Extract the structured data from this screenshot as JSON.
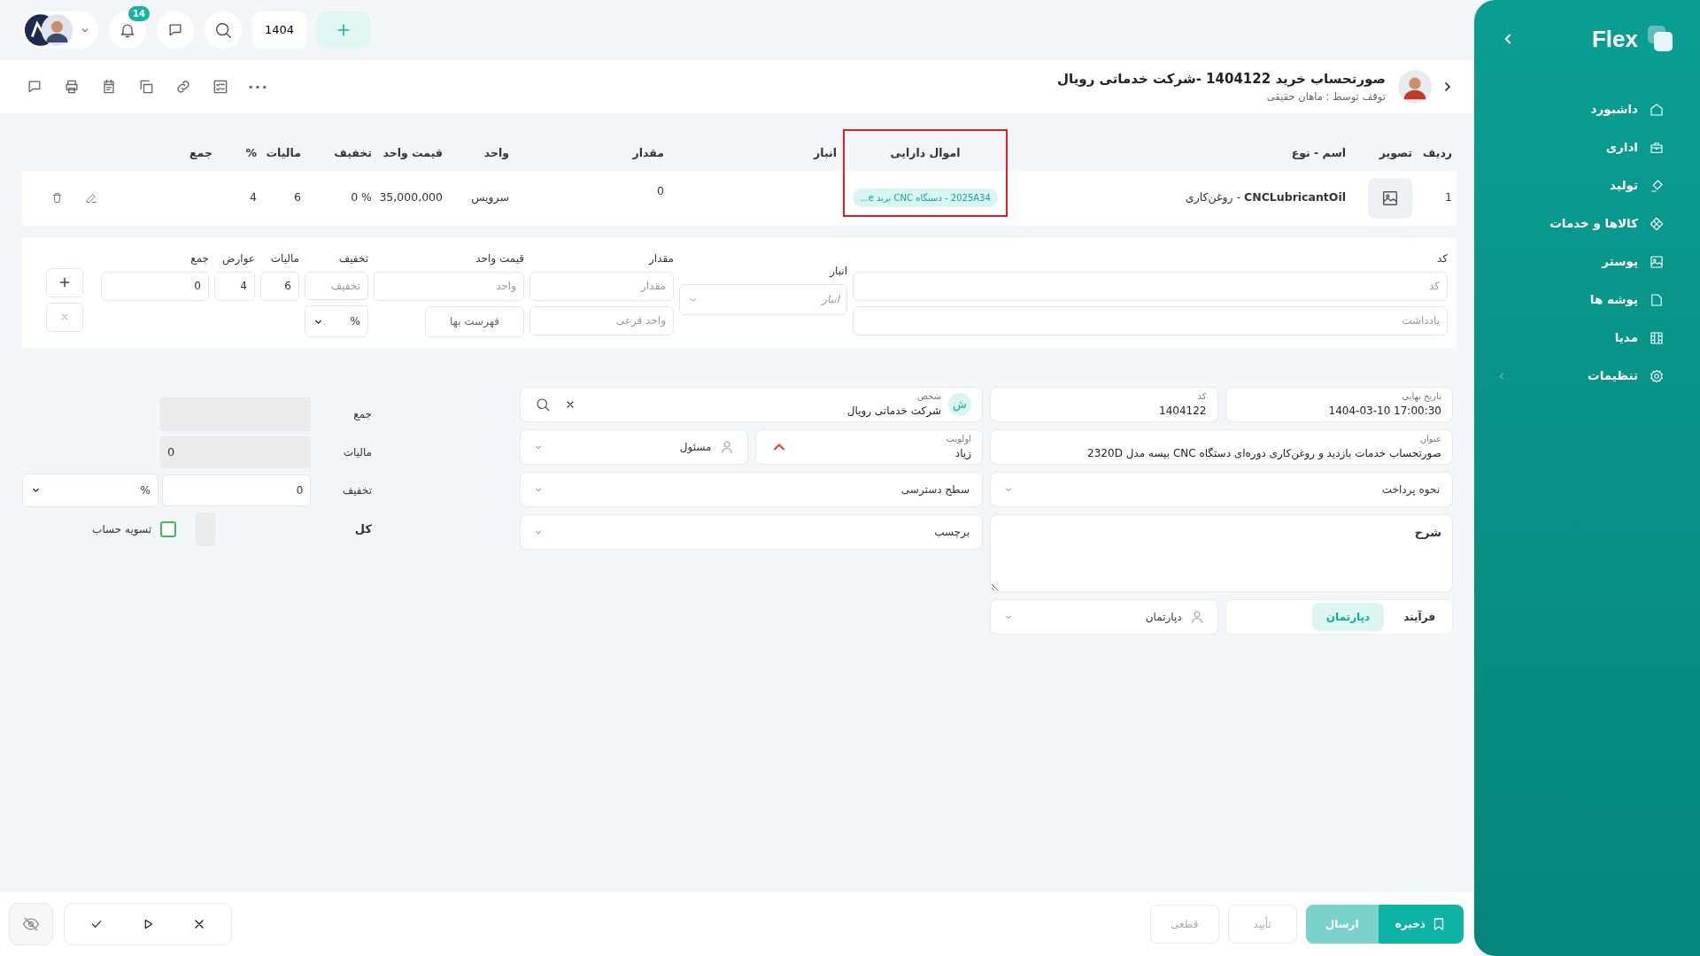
{
  "sidebar": {
    "logo": "Flex",
    "items": [
      {
        "label": "داشبورد",
        "has_submenu": false
      },
      {
        "label": "اداری",
        "has_submenu": false
      },
      {
        "label": "تولید",
        "has_submenu": false
      },
      {
        "label": "کالاها و خدمات",
        "has_submenu": false
      },
      {
        "label": "پوستر",
        "has_submenu": false
      },
      {
        "label": "پوشه ها",
        "has_submenu": false
      },
      {
        "label": "مدیا",
        "has_submenu": false
      },
      {
        "label": "تنظیمات",
        "has_submenu": true
      }
    ]
  },
  "topbar": {
    "notification_count": "14",
    "year": "1404"
  },
  "header": {
    "title": "صورتحساب خرید 1404122 -شرکت خدماتی رویال",
    "subtitle": "توقف توسط : ماهان حقیقی"
  },
  "items_table": {
    "columns": [
      {
        "label": "ردیف",
        "highlighted": false
      },
      {
        "label": "تصویر",
        "highlighted": false
      },
      {
        "label": "اسم - نوع",
        "highlighted": false
      },
      {
        "label": "اموال دارایی",
        "highlighted": true
      },
      {
        "label": "انبار",
        "highlighted": false
      },
      {
        "label": "مقدار",
        "highlighted": false
      },
      {
        "label": "واحد",
        "highlighted": false
      },
      {
        "label": "قیمت واحد",
        "highlighted": false
      },
      {
        "label": "تخفیف",
        "highlighted": false
      },
      {
        "label": "مالیات",
        "highlighted": false
      },
      {
        "label": "%",
        "highlighted": false
      },
      {
        "label": "جمع",
        "highlighted": false
      }
    ],
    "rows": [
      {
        "index": "1",
        "name_type": "**CNCLubricantOil** - روغن‌کاری",
        "asset": "2025A34 - دستگاه CNC برند e...",
        "quantity": "0",
        "unit": "سرویس",
        "unit_price": "35,000,000",
        "discount": "0 %",
        "tax": "6",
        "percent": "4"
      }
    ]
  },
  "entry_form": {
    "code": {
      "label": "کد",
      "placeholder": "کد"
    },
    "note": {
      "placeholder": "یادداشت"
    },
    "warehouse": {
      "label": "انبار",
      "placeholder": "انبار"
    },
    "quantity": {
      "label": "مقدار",
      "placeholder": "مقدار"
    },
    "sub_unit": {
      "placeholder": "واحد فرعی"
    },
    "unit_price": {
      "label": "قیمت واحد",
      "placeholder": "واحد"
    },
    "price_list_button": "فهرست بها",
    "discount": {
      "label": "تخفیف",
      "placeholder": "تخفیف"
    },
    "discount_type": "%",
    "tax": {
      "label": "مالیات",
      "value": "6"
    },
    "duty": {
      "label": "عوارض",
      "value": "4"
    },
    "total": {
      "label": "جمع",
      "value": "0"
    }
  },
  "details": {
    "due_date": {
      "label": "تاریخ نهایی",
      "value": "1404-03-10 17:00:30"
    },
    "code": {
      "label": "کد",
      "value": "1404122"
    },
    "person": {
      "label": "شخص",
      "value": "شرکت خدماتی رویال",
      "initial": "ش"
    },
    "subject": {
      "label": "عنوان",
      "value": "صورتحساب خدمات بازدید و روغن‌کاری دوره‌ای دستگاه CNC بیسه مدل 2320D"
    },
    "priority": {
      "label": "اولویت",
      "value": "زیاد",
      "kind": "high"
    },
    "owner": {
      "label": "مسئول"
    },
    "payment_method": {
      "label": "نحوه پرداخت"
    },
    "access_level": {
      "label": "سطح دسترسی"
    },
    "description": {
      "placeholder": "شرح"
    },
    "tag": {
      "label": "برچسب"
    },
    "tabs": [
      {
        "label": "فرآیند",
        "selected": false
      },
      {
        "label": "دپارتمان",
        "selected": true
      }
    ],
    "department": {
      "label": "دپارتمان"
    }
  },
  "summary": {
    "subtotal": {
      "label": "جمع"
    },
    "tax": {
      "label": "مالیات",
      "value": "0"
    },
    "discount": {
      "label": "تخفیف",
      "value": "0",
      "type": "%"
    },
    "total": {
      "label": "کل"
    },
    "settle": {
      "label": "تسویه حساب",
      "checked": false
    }
  },
  "actions": [
    {
      "label": "ذخیره",
      "kind": "primary",
      "disabled": false
    },
    {
      "label": "ارسال",
      "kind": "secondary",
      "disabled": false
    },
    {
      "label": "تأیید",
      "kind": "plain",
      "disabled": true
    },
    {
      "label": "قطعی",
      "kind": "plain",
      "disabled": true
    }
  ]
}
